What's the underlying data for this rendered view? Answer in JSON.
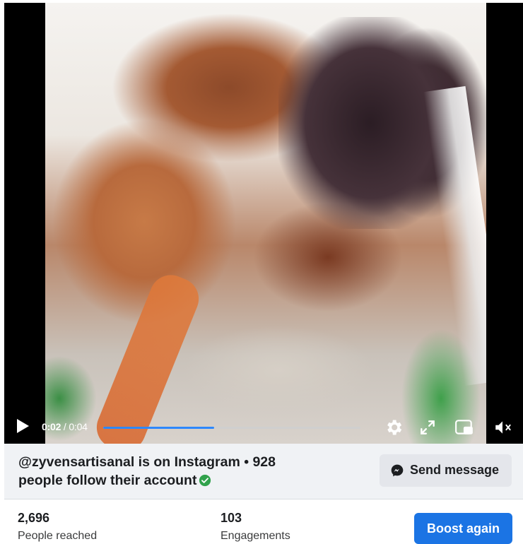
{
  "player": {
    "time_current": "0:02",
    "time_separator": " / ",
    "time_total": "0:04",
    "progress_fraction": 0.43,
    "icons": [
      "play-icon",
      "gear-icon",
      "fullscreen-icon",
      "picture-in-picture-icon",
      "muted-volume-icon"
    ],
    "accent_color": "#2d88ff"
  },
  "info": {
    "text": "@zyvensartisanal is on Instagram • 928 people follow their account",
    "send_label": "Send message"
  },
  "stats": {
    "reached_value": "2,696",
    "reached_label": "People reached",
    "engagements_value": "103",
    "engagements_label": "Engagements",
    "boost_label": "Boost again",
    "boost_color": "#1b74e4"
  }
}
